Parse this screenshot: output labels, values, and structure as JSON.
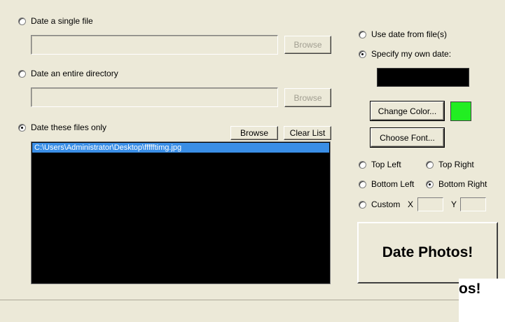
{
  "source_options": {
    "single_file": {
      "label": "Date a single file",
      "selected": false,
      "browse_label": "Browse",
      "path_value": ""
    },
    "directory": {
      "label": "Date an entire directory",
      "selected": false,
      "browse_label": "Browse",
      "path_value": ""
    },
    "files_only": {
      "label": "Date these files only",
      "selected": true,
      "browse_label": "Browse",
      "clear_label": "Clear List"
    }
  },
  "file_list": [
    "C:\\Users\\Administrator\\Desktop\\ffffftimg.jpg"
  ],
  "date_source": {
    "use_file_date": {
      "label": "Use date from file(s)",
      "selected": false
    },
    "own_date": {
      "label": "Specify my own date:",
      "selected": true,
      "value": ""
    }
  },
  "style": {
    "change_color_label": "Change Color...",
    "color_swatch": "#22ee22",
    "choose_font_label": "Choose Font..."
  },
  "position": {
    "top_left": "Top Left",
    "top_right": "Top Right",
    "bottom_left": "Bottom Left",
    "bottom_right": "Bottom Right",
    "custom": "Custom",
    "x_label": "X",
    "y_label": "Y",
    "selected": "bottom_right"
  },
  "action": {
    "date_photos_label": "Date Photos!",
    "ghost_text": "os!"
  }
}
